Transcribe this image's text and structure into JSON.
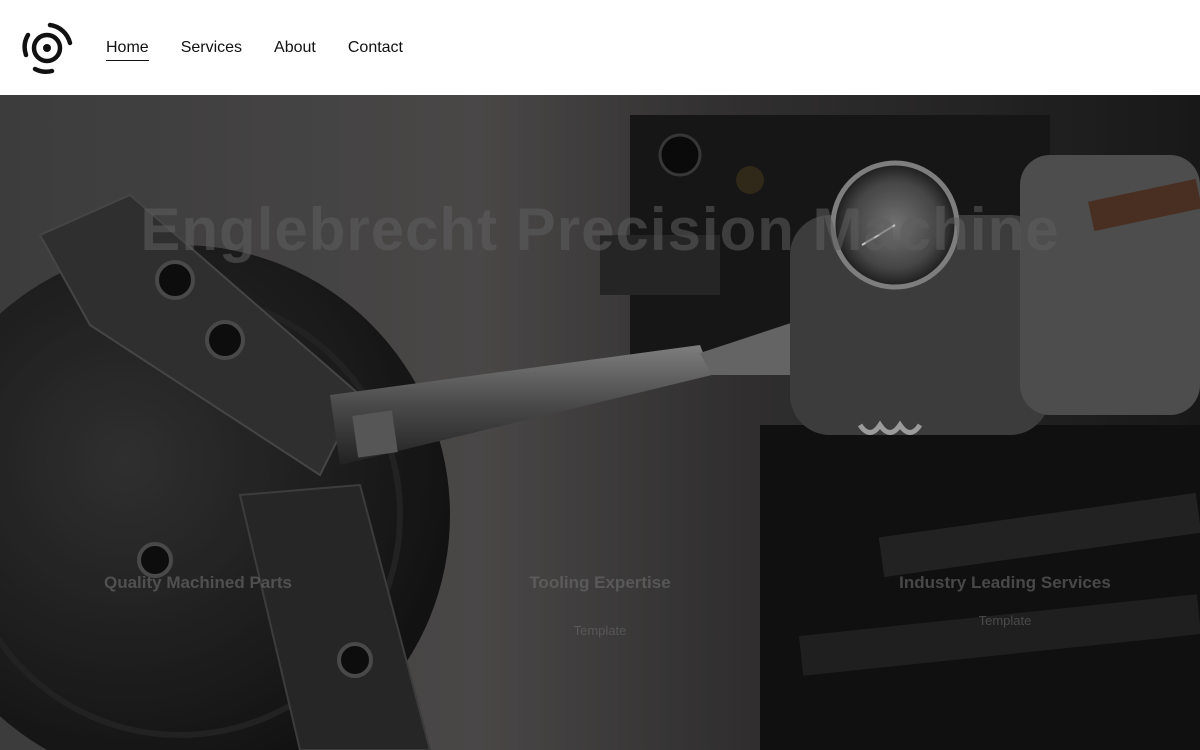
{
  "header": {
    "logo_icon": "camera-lens-logo",
    "nav": [
      {
        "label": "Home",
        "active": true
      },
      {
        "label": "Services",
        "active": false
      },
      {
        "label": "About",
        "active": false
      },
      {
        "label": "Contact",
        "active": false
      }
    ]
  },
  "hero": {
    "title": "Englebrecht Precision Machine",
    "features": [
      {
        "title": "Quality Machined Parts",
        "subtitle": ""
      },
      {
        "title": "Tooling Expertise",
        "subtitle": "Template"
      },
      {
        "title": "Industry Leading Services",
        "subtitle": "Template"
      }
    ]
  },
  "colors": {
    "header_bg": "#ffffff",
    "nav_text": "#111111",
    "hero_overlay": "#2b2b2b"
  }
}
